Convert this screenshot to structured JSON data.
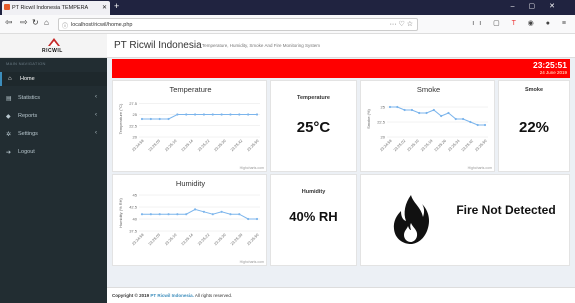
{
  "browser": {
    "tab_title": "PT Ricwil Indonesia TEMPERA",
    "url": "localhost/ricwil/home.php"
  },
  "sidebar": {
    "brand": "RICWIL",
    "section_label": "MAIN NAVIGATION",
    "items": [
      {
        "label": "Home",
        "icon": "home-icon",
        "active": true
      },
      {
        "label": "Statistics",
        "icon": "chart-icon",
        "active": false
      },
      {
        "label": "Reports",
        "icon": "report-icon",
        "active": false
      },
      {
        "label": "Settings",
        "icon": "gear-icon",
        "active": false
      },
      {
        "label": "Logout",
        "icon": "logout-icon",
        "active": false
      }
    ]
  },
  "header": {
    "title": "PT Ricwil Indonesia",
    "subtitle": "Temperature, Humidity, Smoke And Fire Monitoring System"
  },
  "status_bar": {
    "time": "23:25:51",
    "date": "24 June 2019",
    "color": "#ff0000"
  },
  "cards": {
    "temperature_label": "Temperature",
    "temperature_value": "25°C",
    "smoke_label": "Smoke",
    "smoke_value": "22%",
    "humidity_label": "Humidity",
    "humidity_value": "40% RH",
    "fire_status": "Fire Not Detected"
  },
  "chart_data": [
    {
      "type": "line",
      "title": "Temperature",
      "ylabel": "Temperature (°C)",
      "ylim": [
        20,
        28
      ],
      "yticks": [
        "20",
        "22.5",
        "25",
        "27.5"
      ],
      "x": [
        "23:24:58",
        "23:25:02",
        "23:25:06",
        "23:25:10",
        "23:25:14",
        "23:25:18",
        "23:25:22",
        "23:25:26",
        "23:25:30",
        "23:25:34",
        "23:25:38",
        "23:25:42",
        "23:25:46",
        "23:25:50"
      ],
      "xticks": [
        "23:24:58",
        "23:25:03",
        "23:25:10",
        "23:25:14",
        "23:25:22",
        "23:25:30",
        "23:25:42",
        "23:25:50"
      ],
      "values": [
        24,
        24,
        24,
        24,
        25,
        25,
        25,
        25,
        25,
        25,
        25,
        25,
        25,
        25
      ],
      "color": "#7cb5ec",
      "credit": "Highcharts.com"
    },
    {
      "type": "line",
      "title": "Smoke",
      "ylabel": "Smoke (%)",
      "ylim": [
        20,
        26
      ],
      "yticks": [
        "20",
        "22.5",
        "25"
      ],
      "x": [
        "23:24:58",
        "23:25:02",
        "23:25:06",
        "23:25:10",
        "23:25:14",
        "23:25:18",
        "23:25:22",
        "23:25:26",
        "23:25:30",
        "23:25:34",
        "23:25:38",
        "23:25:42",
        "23:25:46",
        "23:25:50"
      ],
      "xticks": [
        "23:24:58",
        "23:25:02",
        "23:25:10",
        "23:25:18",
        "23:25:26",
        "23:25:34",
        "23:25:42",
        "23:25:50"
      ],
      "values": [
        25,
        25,
        24.5,
        24.5,
        24,
        24,
        24.5,
        23.5,
        24,
        23,
        23,
        22.5,
        22,
        22
      ],
      "color": "#7cb5ec",
      "credit": "Highcharts.com"
    },
    {
      "type": "line",
      "title": "Humidity",
      "ylabel": "Humidity (% RH)",
      "ylim": [
        37.5,
        45
      ],
      "yticks": [
        "37.5",
        "40",
        "42.5",
        "45"
      ],
      "x": [
        "23:24:58",
        "23:25:02",
        "23:25:06",
        "23:25:10",
        "23:25:14",
        "23:25:18",
        "23:25:22",
        "23:25:26",
        "23:25:30",
        "23:25:34",
        "23:25:38",
        "23:25:42",
        "23:25:46",
        "23:25:50"
      ],
      "xticks": [
        "23:24:58",
        "23:25:03",
        "23:25:10",
        "23:25:14",
        "23:25:22",
        "23:25:30",
        "23:25:38",
        "23:25:50"
      ],
      "values": [
        41,
        41,
        41,
        41,
        41,
        41,
        42,
        41.5,
        41,
        41.5,
        41,
        41,
        40,
        40
      ],
      "color": "#7cb5ec",
      "credit": "Highcharts.com"
    }
  ],
  "footer": {
    "prefix": "Copyright © 2019",
    "company": "PT Ricwil Indonesia.",
    "suffix": "All rights reserved."
  }
}
